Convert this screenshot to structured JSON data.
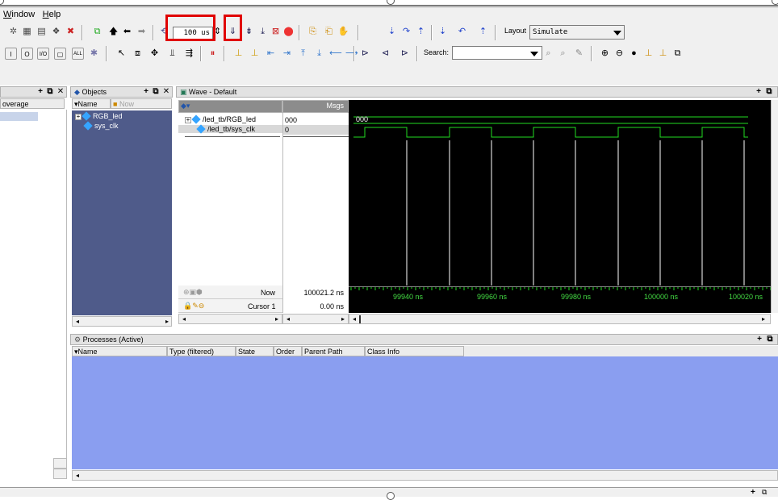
{
  "menu": {
    "window": "Window",
    "window_u": "W",
    "window_rest": "indow",
    "help_u": "H",
    "help_rest": "elp"
  },
  "toolbar": {
    "run_length": "100 us",
    "layout_label": "Layout",
    "layout_value": "Simulate",
    "search_label": "Search:",
    "search_value": ""
  },
  "left_pane": {
    "coverage_label": "overage"
  },
  "objects_pane": {
    "title": "Objects",
    "col_name": "Name",
    "col_now": "Now",
    "items": [
      {
        "label": "RGB_led",
        "expandable": true
      },
      {
        "label": "sys_clk",
        "expandable": false
      }
    ]
  },
  "wave_pane": {
    "title": "Wave - Default",
    "msgs_label": "Msgs",
    "signals": [
      {
        "path": "/led_tb/RGB_led",
        "value": "000"
      },
      {
        "path": "/led_tb/sys_clk",
        "value": "0"
      }
    ],
    "now_label": "Now",
    "now_value": "100021.2 ns",
    "cursor_label": "Cursor 1",
    "cursor_value": "0.00 ns",
    "bus_value_label": "000",
    "tick_labels": [
      "99940 ns",
      "99960 ns",
      "99980 ns",
      "100000 ns",
      "100020 ns"
    ]
  },
  "processes_pane": {
    "title": "Processes (Active)",
    "columns": [
      "Name",
      "Type (filtered)",
      "State",
      "Order",
      "Parent Path",
      "Class Info"
    ]
  },
  "colors": {
    "wave_bg": "#000000",
    "signal_green": "#22dd22",
    "objects_bg": "#4f5b8a",
    "processes_bg": "#8a9ef0",
    "highlight_red": "#e00000"
  }
}
